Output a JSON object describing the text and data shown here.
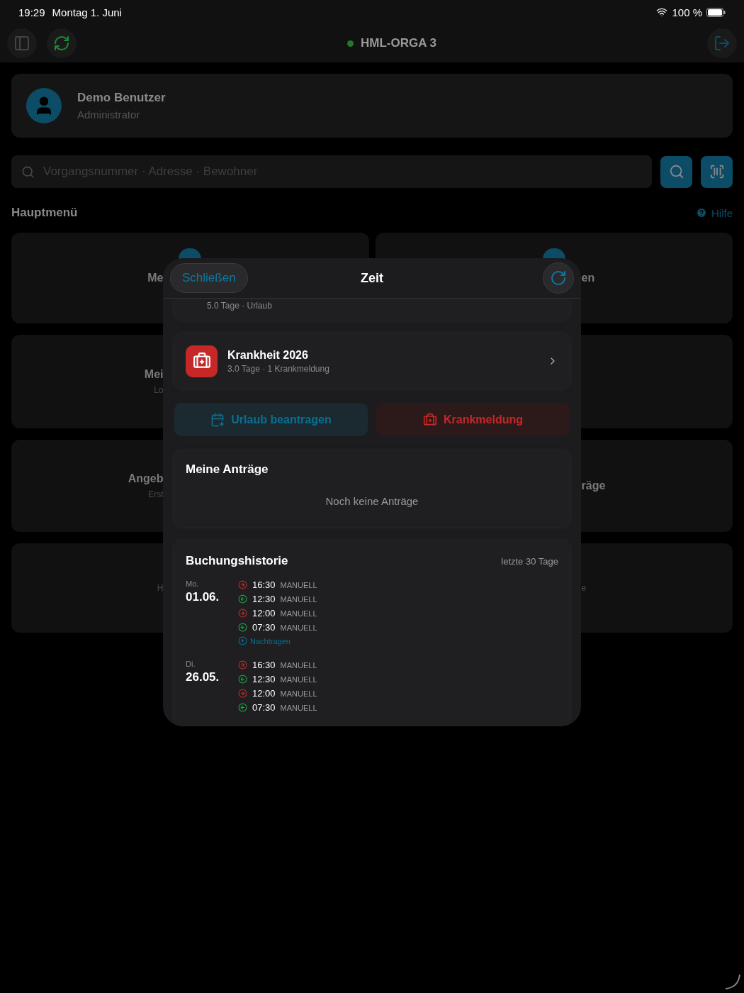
{
  "status_bar": {
    "time": "19:29",
    "date": "Montag 1. Juni",
    "battery": "100 %"
  },
  "toolbar": {
    "title": "HML-ORGA 3",
    "online": true
  },
  "user": {
    "name": "Demo Benutzer",
    "role": "Administrator"
  },
  "search": {
    "placeholder": "Vorgangsnummer · Adresse · Bewohner"
  },
  "menu": {
    "title": "Hauptmenü",
    "help": "Hilfe"
  },
  "tiles": [
    {
      "left": {
        "label": "Me"
      },
      "right": {
        "label": "en"
      },
      "icons": true
    },
    {
      "left": {
        "label": "Mei",
        "sublabel": "Lo"
      }
    },
    {
      "left": {
        "label": "Angeb",
        "sublabel": "Erst"
      },
      "right": {
        "label": "räge"
      }
    },
    {
      "left": {
        "sublabel": "H"
      },
      "right": {
        "sublabel": "e"
      }
    }
  ],
  "modal": {
    "close": "Schließen",
    "title": "Zeit",
    "summaries": [
      {
        "kind": "vacation",
        "subtitle": "5.0 Tage · Urlaub"
      },
      {
        "kind": "sick",
        "title": "Krankheit 2026",
        "subtitle": "3.0 Tage · 1 Krankmeldung"
      }
    ],
    "actions": [
      {
        "kind": "vacation",
        "label": "Urlaub beantragen"
      },
      {
        "kind": "sick",
        "label": "Krankmeldung"
      }
    ],
    "requests": {
      "title": "Meine Anträge",
      "empty": "Noch keine Anträge"
    },
    "history": {
      "title": "Buchungshistorie",
      "range": "letzte 30 Tage",
      "days": [
        {
          "weekday": "Mo.",
          "date": "01.06.",
          "add": "Nachtragen",
          "bookings": [
            {
              "kind": "out",
              "time": "16:30",
              "source": "MANUELL"
            },
            {
              "kind": "in",
              "time": "12:30",
              "source": "MANUELL"
            },
            {
              "kind": "out",
              "time": "12:00",
              "source": "MANUELL"
            },
            {
              "kind": "in",
              "time": "07:30",
              "source": "MANUELL"
            }
          ]
        },
        {
          "weekday": "Di.",
          "date": "26.05.",
          "bookings": [
            {
              "kind": "out",
              "time": "16:30",
              "source": "MANUELL"
            },
            {
              "kind": "in",
              "time": "12:30",
              "source": "MANUELL"
            },
            {
              "kind": "out",
              "time": "12:00",
              "source": "MANUELL"
            },
            {
              "kind": "in",
              "time": "07:30",
              "source": "MANUELL"
            }
          ]
        }
      ]
    }
  }
}
